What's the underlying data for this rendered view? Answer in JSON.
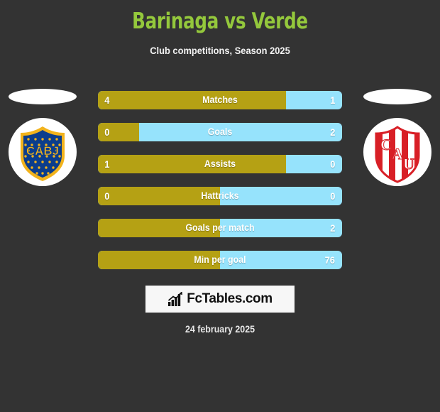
{
  "header": {
    "title": "Barinaga vs Verde",
    "subtitle": "Club competitions, Season 2025",
    "title_color": "#94c83c",
    "subtitle_color": "#f2f2f2"
  },
  "theme": {
    "background": "#333333",
    "home_color": "#b5a114",
    "away_color": "#96e3fc",
    "brand_bg": "#f7f7f7"
  },
  "teams": {
    "home": {
      "crest_name": "boca-juniors-cabj-crest",
      "crest_text": "CABJ"
    },
    "away": {
      "crest_name": "union-santa-fe-cau-crest",
      "crest_text": "CAU"
    }
  },
  "stats": [
    {
      "label": "Matches",
      "home": "4",
      "away": "1",
      "home_pct": 77
    },
    {
      "label": "Goals",
      "home": "0",
      "away": "2",
      "home_pct": 17
    },
    {
      "label": "Assists",
      "home": "1",
      "away": "0",
      "home_pct": 77
    },
    {
      "label": "Hattricks",
      "home": "0",
      "away": "0",
      "home_pct": 50
    },
    {
      "label": "Goals per match",
      "home": "",
      "away": "2",
      "home_pct": 50
    },
    {
      "label": "Min per goal",
      "home": "",
      "away": "76",
      "home_pct": 50
    }
  ],
  "brand": {
    "text": "FcTables.com",
    "icon": "bar-chart-arrow-icon"
  },
  "footer": {
    "date": "24 february 2025"
  },
  "chart_data": {
    "type": "bar",
    "title": "Barinaga vs Verde",
    "subtitle": "Club competitions, Season 2025",
    "categories": [
      "Matches",
      "Goals",
      "Assists",
      "Hattricks",
      "Goals per match",
      "Min per goal"
    ],
    "series": [
      {
        "name": "Barinaga",
        "values": [
          4,
          0,
          1,
          0,
          null,
          null
        ]
      },
      {
        "name": "Verde",
        "values": [
          1,
          2,
          0,
          0,
          2,
          76
        ]
      }
    ],
    "home_fill_pct": [
      77,
      17,
      77,
      50,
      50,
      50
    ],
    "xlabel": "",
    "ylabel": "",
    "legend": [
      "Barinaga",
      "Verde"
    ],
    "grid": false
  }
}
